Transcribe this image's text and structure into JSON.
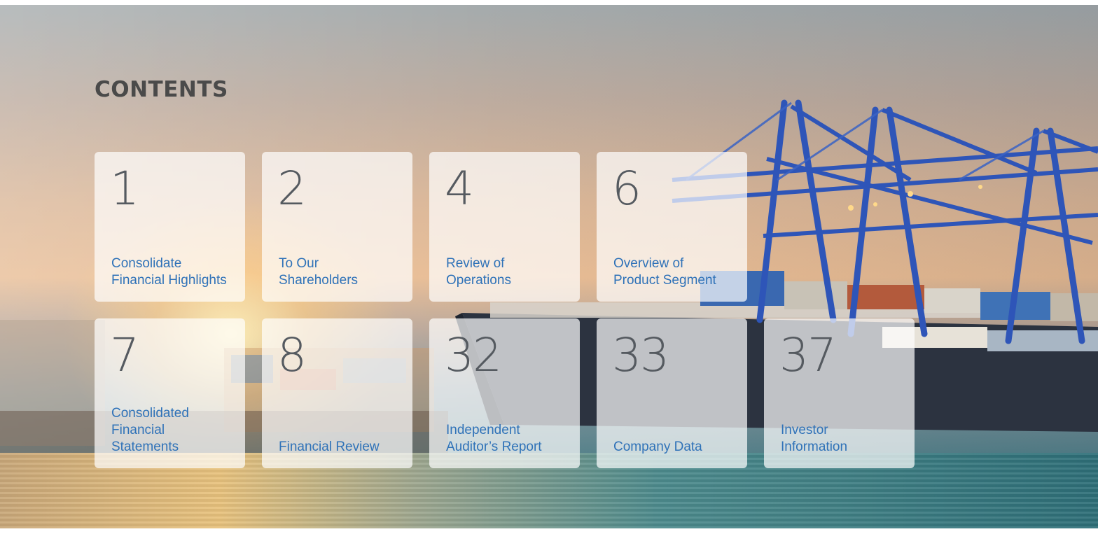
{
  "page": {
    "title": "CONTENTS"
  },
  "items": [
    {
      "page": "1",
      "label": "Consolidate\nFinancial Highlights"
    },
    {
      "page": "2",
      "label": "To Our\nShareholders"
    },
    {
      "page": "4",
      "label": "Review of\nOperations"
    },
    {
      "page": "6",
      "label": "Overview of\nProduct Segment"
    },
    {
      "page": "7",
      "label": "Consolidated\nFinancial\nStatements"
    },
    {
      "page": "8",
      "label": "Financial Review"
    },
    {
      "page": "32",
      "label": "Independent\nAuditor’s Report"
    },
    {
      "page": "33",
      "label": "Company Data"
    },
    {
      "page": "37",
      "label": "Investor\nInformation"
    }
  ],
  "colors": {
    "title": "#4a4a4a",
    "number": "#555a60",
    "label": "#2f72b8",
    "crane": "#2e55b8",
    "hull": "#2c3340"
  }
}
